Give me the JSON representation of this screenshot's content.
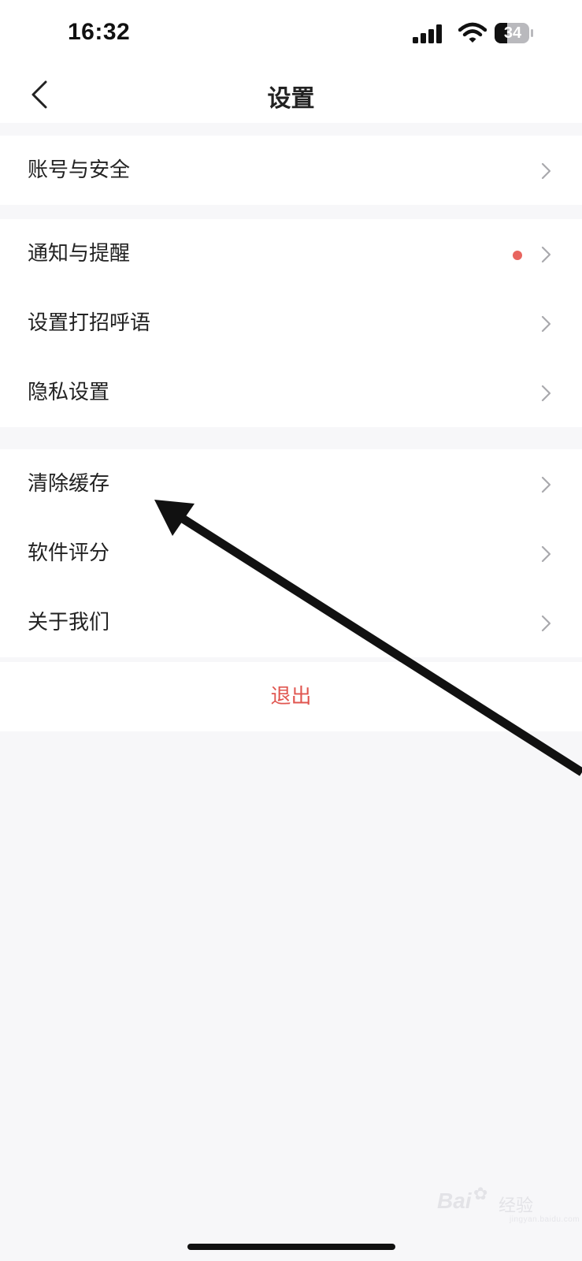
{
  "status_bar": {
    "time": "16:32",
    "battery_level": "34",
    "icons": [
      "signal-icon",
      "wifi-icon",
      "battery-icon"
    ]
  },
  "nav": {
    "title": "设置",
    "back_icon": "chevron-left-icon"
  },
  "groups": [
    {
      "items": [
        {
          "label": "账号与安全",
          "badge": false
        }
      ]
    },
    {
      "items": [
        {
          "label": "通知与提醒",
          "badge": true
        },
        {
          "label": "设置打招呼语",
          "badge": false
        },
        {
          "label": "隐私设置",
          "badge": false
        }
      ]
    },
    {
      "items": [
        {
          "label": "清除缓存",
          "badge": false
        },
        {
          "label": "软件评分",
          "badge": false
        },
        {
          "label": "关于我们",
          "badge": false
        }
      ]
    }
  ],
  "logout": {
    "label": "退出"
  },
  "watermark": {
    "brand": "Bai",
    "text": "经验",
    "sub": "jingyan.baidu.com"
  },
  "colors": {
    "background": "#f7f7f9",
    "surface": "#ffffff",
    "text": "#222222",
    "chevron": "#a9a9ad",
    "badge": "#e8655f",
    "logout": "#e05650"
  }
}
